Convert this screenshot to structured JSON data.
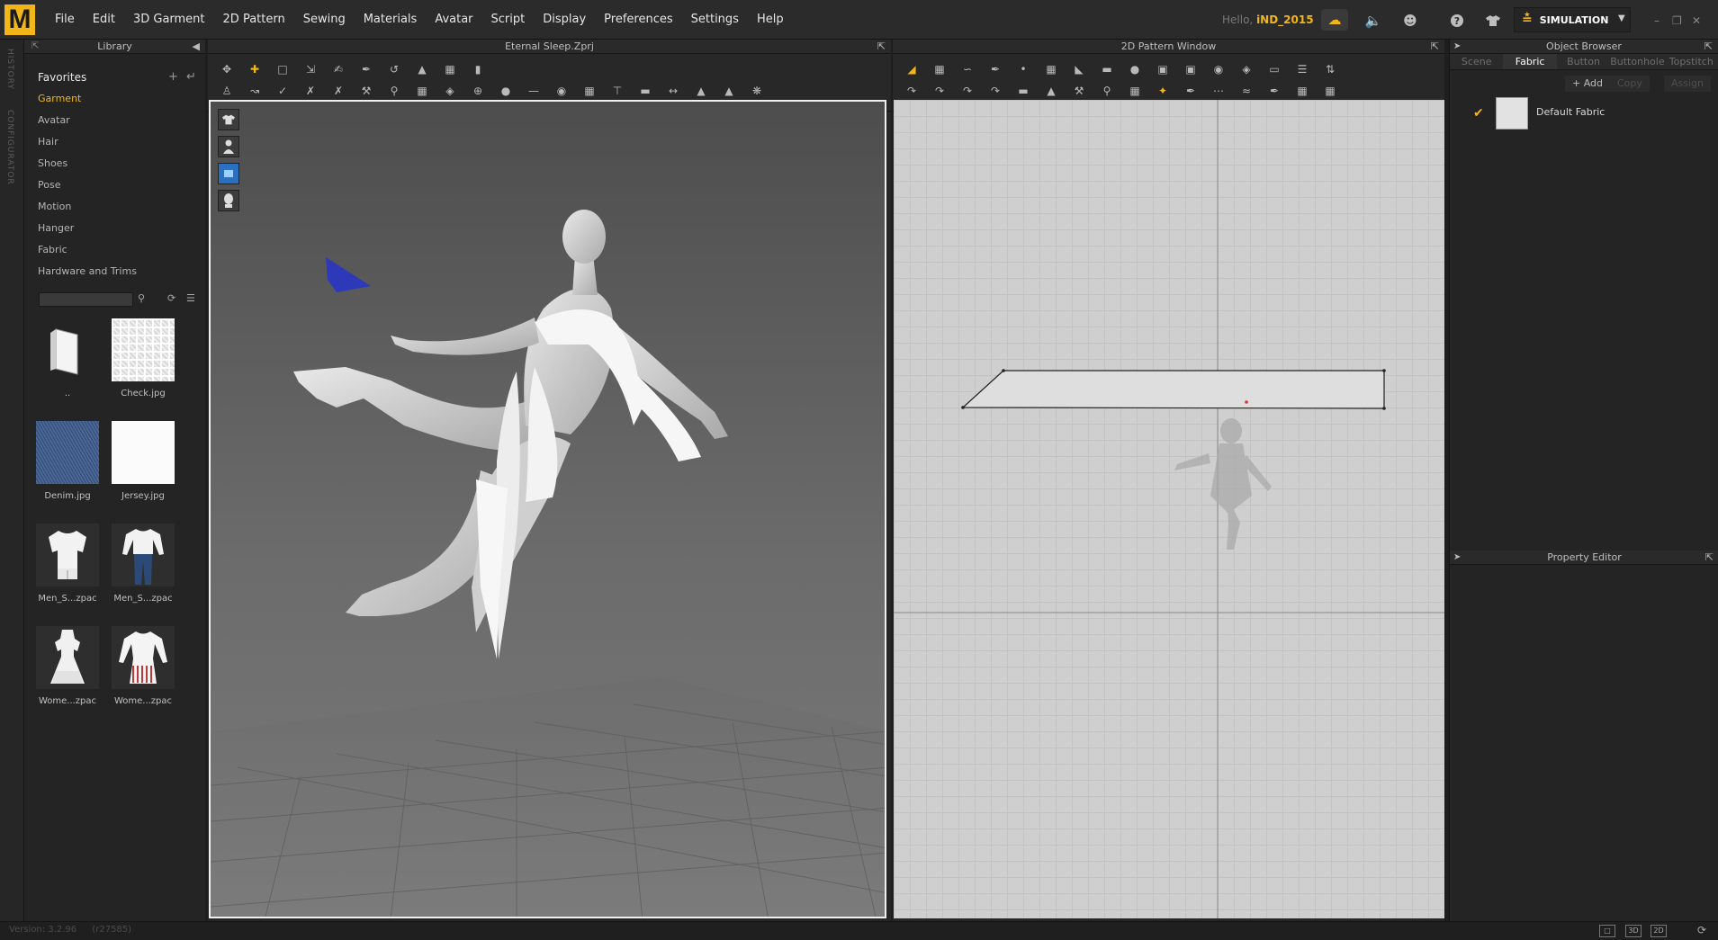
{
  "app": {
    "logo": "M"
  },
  "menu": [
    "File",
    "Edit",
    "3D Garment",
    "2D Pattern",
    "Sewing",
    "Materials",
    "Avatar",
    "Script",
    "Display",
    "Preferences",
    "Settings",
    "Help"
  ],
  "user": {
    "hello": "Hello,",
    "name": "iND_2015"
  },
  "mode": {
    "label": "SIMULATION"
  },
  "side_tabs": [
    "HISTORY",
    "CONFIGURATOR"
  ],
  "library": {
    "title": "Library",
    "favorites": "Favorites",
    "items": [
      "Garment",
      "Avatar",
      "Hair",
      "Shoes",
      "Pose",
      "Motion",
      "Hanger",
      "Fabric",
      "Hardware and Trims"
    ],
    "active": "Garment",
    "thumbs": [
      {
        "caption": "..",
        "kind": "folder"
      },
      {
        "caption": "Check.jpg",
        "kind": "check"
      },
      {
        "caption": "Denim.jpg",
        "kind": "denim"
      },
      {
        "caption": "Jersey.jpg",
        "kind": "jersey"
      },
      {
        "caption": "Men_S...zpac",
        "kind": "shirt-shorts"
      },
      {
        "caption": "Men_S...zpac",
        "kind": "shirt-pants"
      },
      {
        "caption": "Wome...zpac",
        "kind": "dress"
      },
      {
        "caption": "Wome...zpac",
        "kind": "dress-striped"
      }
    ]
  },
  "view3d": {
    "title": "Eternal Sleep.Zprj"
  },
  "view2d": {
    "title": "2D Pattern Window"
  },
  "object_browser": {
    "title": "Object Browser",
    "tabs": [
      "Scene",
      "Fabric",
      "Button",
      "Buttonhole",
      "Topstitch"
    ],
    "active_tab": "Fabric",
    "actions": {
      "add": "+ Add",
      "copy": "Copy",
      "assign": "Assign"
    },
    "fabrics": [
      {
        "name": "Default Fabric",
        "checked": true
      }
    ]
  },
  "property_editor": {
    "title": "Property Editor"
  },
  "status": {
    "version": "Version: 3.2.96",
    "build": "(r27585)",
    "views": [
      "□",
      "3D",
      "2D"
    ]
  },
  "colors": {
    "accent": "#f2b619",
    "panel": "#242424",
    "viewport_bg": "#6b6b6b",
    "pattern_bg": "#cfcfcf"
  }
}
